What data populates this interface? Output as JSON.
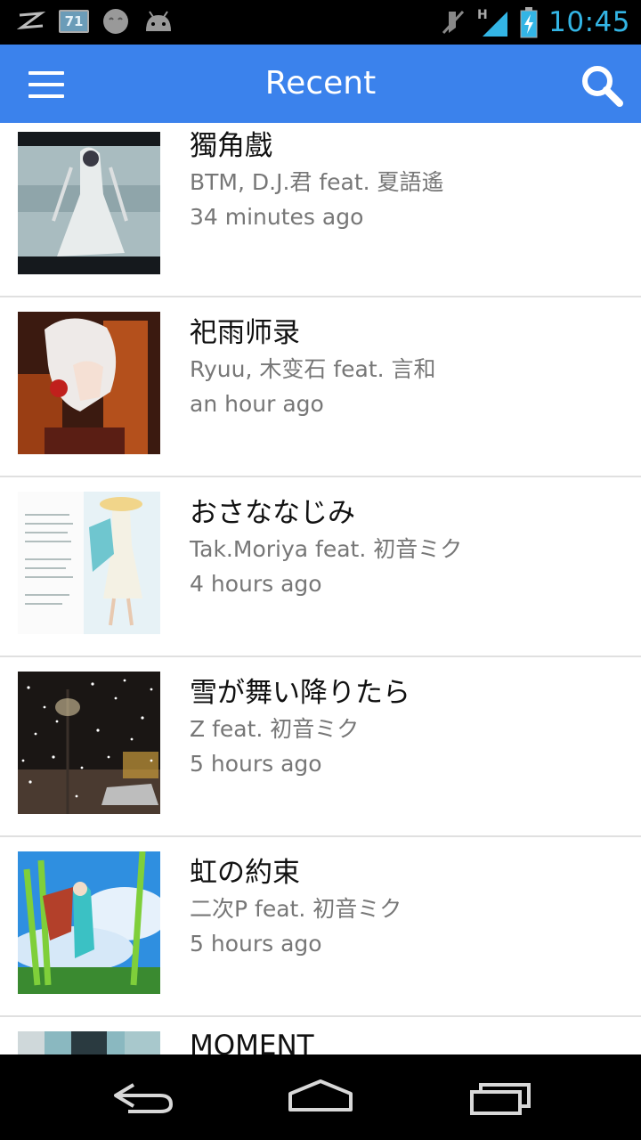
{
  "status_bar": {
    "icons_left": [
      "signal-z-icon",
      "battery-percent-icon",
      "smiley-icon",
      "android-icon"
    ],
    "battery_badge": "71",
    "icons_right": [
      "mute-icon",
      "network-h-icon",
      "battery-charging-icon"
    ],
    "network_type": "H",
    "time": "10:45",
    "accent_color": "#33b5e5"
  },
  "action_bar": {
    "title": "Recent",
    "menu_icon": "hamburger-menu-icon",
    "search_icon": "search-icon",
    "color": "#3b82ec"
  },
  "tracks": [
    {
      "title": "獨角戲",
      "artist": "BTM, D.J.君 feat. 夏語遙",
      "time": "34 minutes ago"
    },
    {
      "title": "祀雨师录",
      "artist": "Ryuu, 木变石 feat. 言和",
      "time": "an hour ago"
    },
    {
      "title": "おさななじみ",
      "artist": "Tak.Moriya feat. 初音ミク",
      "time": "4 hours ago"
    },
    {
      "title": "雪が舞い降りたら",
      "artist": "Z feat. 初音ミク",
      "time": "5 hours ago"
    },
    {
      "title": "虹の約束",
      "artist": "二次P feat. 初音ミク",
      "time": "5 hours ago"
    },
    {
      "title": "MOMENT",
      "artist": "",
      "time": ""
    }
  ],
  "nav_bar": {
    "buttons": [
      "back-icon",
      "home-icon",
      "recent-apps-icon"
    ]
  }
}
